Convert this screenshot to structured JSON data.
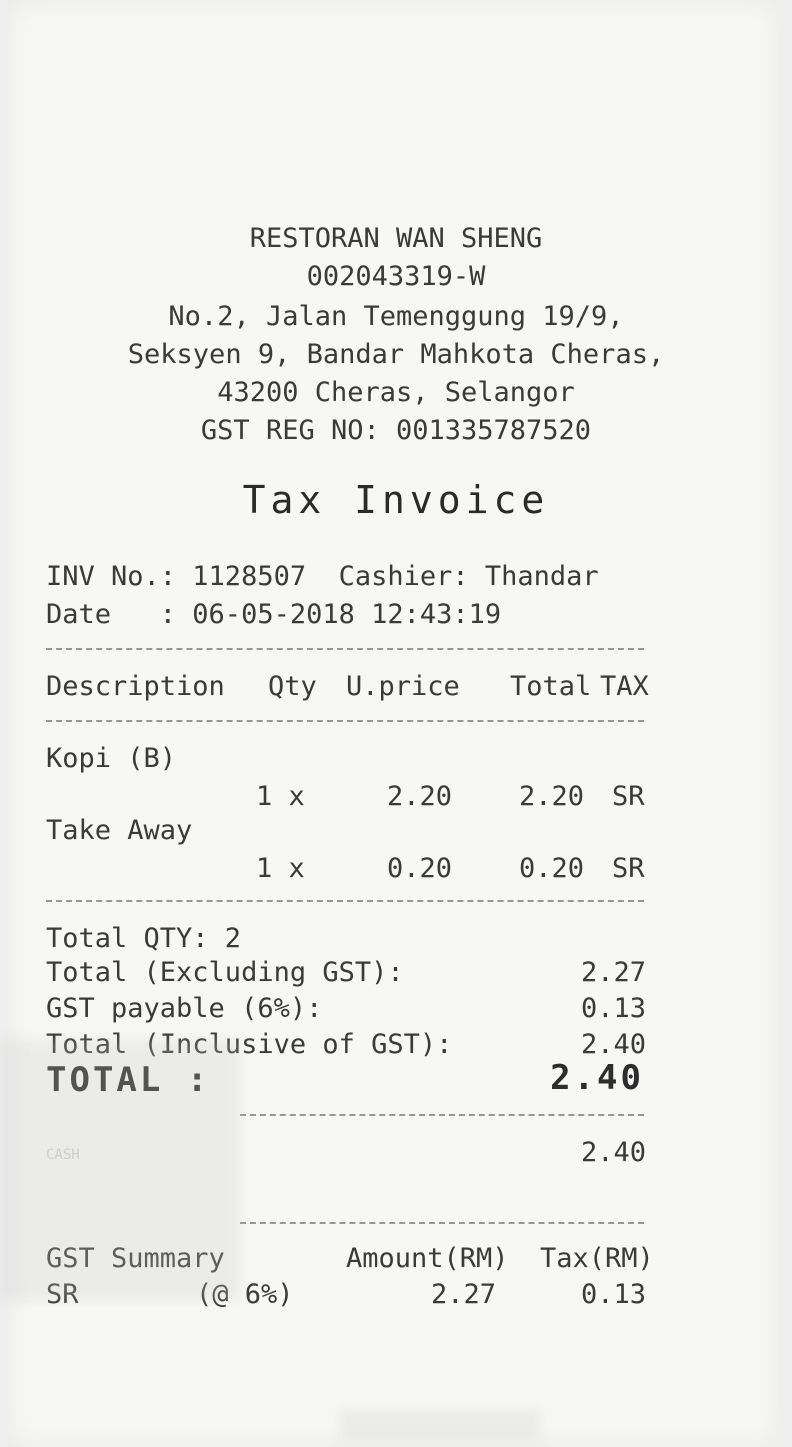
{
  "header": {
    "store_name": "RESTORAN WAN SHENG",
    "company_no": "002043319-W",
    "address_line1": "No.2, Jalan Temenggung 19/9,",
    "address_line2": "Seksyen 9, Bandar Mahkota Cheras,",
    "address_line3": "43200 Cheras, Selangor",
    "gst_reg": "GST REG NO: 001335787520"
  },
  "doc_title": "Tax Invoice",
  "meta": {
    "inv_line": "INV No.: 1128507  Cashier: Thandar",
    "date_line": "Date   : 06-05-2018 12:43:19"
  },
  "columns": {
    "description": "Description",
    "qty": "Qty",
    "uprice": "U.price",
    "total": "Total",
    "tax": "TAX"
  },
  "items": [
    {
      "name": "Kopi (B)",
      "qty": "1 x",
      "uprice": "2.20",
      "total": "2.20",
      "tax": "SR"
    },
    {
      "name": "Take Away",
      "qty": "1 x",
      "uprice": "0.20",
      "total": "0.20",
      "tax": "SR"
    }
  ],
  "totals": {
    "total_qty": "Total QTY: 2",
    "excl_label": "Total (Excluding GST):",
    "excl_value": "2.27",
    "gst_label": "GST payable (6%):",
    "gst_value": "0.13",
    "incl_label": "Total (Inclusive of GST):",
    "incl_value": "2.40",
    "grand_label": "TOTAL :",
    "grand_value": "2.40",
    "paid_label": "CASH",
    "paid_value": "2.40"
  },
  "gst_summary": {
    "title": "GST Summary",
    "amount_header": "Amount(RM)",
    "tax_header": "Tax(RM)",
    "code": "SR",
    "rate": "(@ 6%)",
    "amount": "2.27",
    "tax": "0.13"
  }
}
